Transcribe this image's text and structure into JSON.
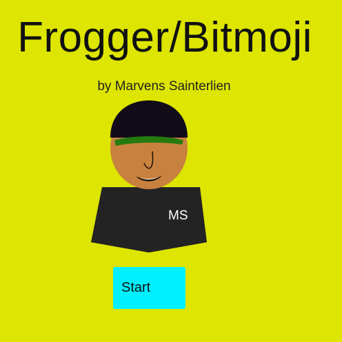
{
  "game": {
    "title": "Frogger/Bitmoji",
    "author": "by Marvens Sainterlien"
  },
  "avatar": {
    "shirt_initials": "MS",
    "colors": {
      "skin": "#c8813e",
      "hair": "#110c18",
      "cap_band": "#257a10",
      "shirt": "#232323",
      "mouth": "#1a0f08",
      "teeth": "#ffffff"
    }
  },
  "controls": {
    "start_label": "Start",
    "start_color": "#00f0ff"
  },
  "background_color": "#dde500"
}
